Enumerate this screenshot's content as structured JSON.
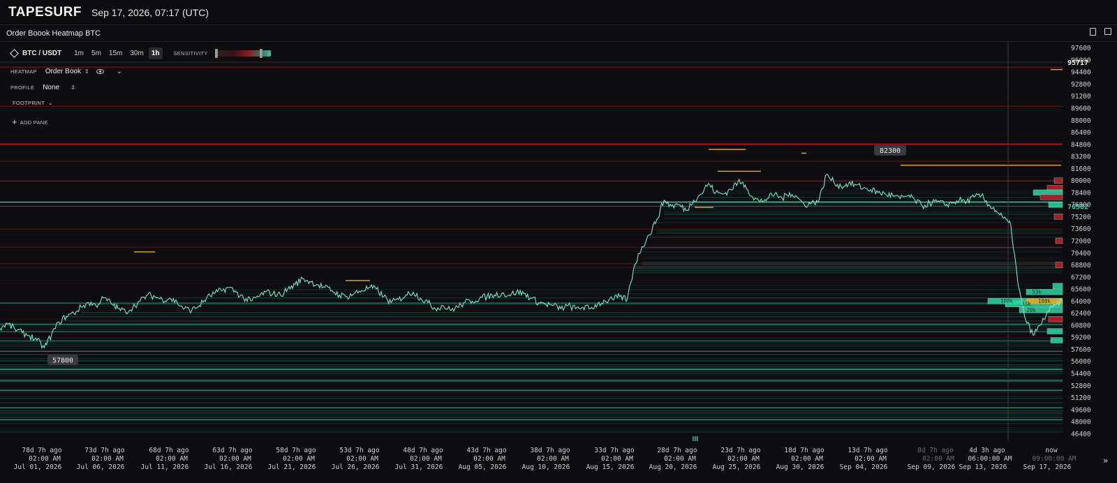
{
  "app": {
    "logo": "TAPESURF",
    "datetime": "Sep 17, 2026, 07:17 (UTC)",
    "pane_title": "Order Boook Heatmap BTC"
  },
  "controls": {
    "pair": "BTC / USDT",
    "timeframes": [
      "1m",
      "5m",
      "15m",
      "30m",
      "1h"
    ],
    "active_timeframe": "1h",
    "sensitivity_label": "SENSITIVITY",
    "heatmap_label": "HEATMAP",
    "heatmap_value": "Order Book",
    "profile_label": "PROFILE",
    "profile_value": "None",
    "footprint_label": "FOOTPRINT",
    "add_pane_label": "ADD PANE"
  },
  "colors": {
    "background": "#0e0e10",
    "bid": "#2fd3a3",
    "ask": "#c0212a",
    "accent": "#f0b429",
    "current_price": "#45d0b0"
  },
  "icons": [
    "binance-diamond-icon",
    "eye-icon",
    "chevron-down-icon",
    "plus-icon",
    "window-icon",
    "collapse-icon"
  ],
  "chart_data": {
    "type": "heatmap",
    "y_ticks": [
      97600,
      96000,
      94400,
      92800,
      91200,
      89600,
      88000,
      86400,
      84800,
      83200,
      81600,
      80000,
      78400,
      76800,
      75200,
      73600,
      72000,
      70400,
      68800,
      67200,
      65600,
      64000,
      62400,
      60800,
      59200,
      57600,
      56000,
      54400,
      52800,
      51200,
      49600,
      48000,
      46400
    ],
    "ylim": [
      45600,
      98400
    ],
    "x_ticks": [
      {
        "rel": "78d 7h ago",
        "time": "02:00 AM",
        "date": "Jul 01, 2026"
      },
      {
        "rel": "73d 7h ago",
        "time": "02:00 AM",
        "date": "Jul 06, 2026"
      },
      {
        "rel": "68d 7h ago",
        "time": "02:00 AM",
        "date": "Jul 11, 2026"
      },
      {
        "rel": "63d 7h ago",
        "time": "02:00 AM",
        "date": "Jul 16, 2026"
      },
      {
        "rel": "58d 7h ago",
        "time": "02:00 AM",
        "date": "Jul 21, 2026"
      },
      {
        "rel": "53d 7h ago",
        "time": "02:00 AM",
        "date": "Jul 26, 2026"
      },
      {
        "rel": "48d 7h ago",
        "time": "02:00 AM",
        "date": "Jul 31, 2026"
      },
      {
        "rel": "43d 7h ago",
        "time": "02:00 AM",
        "date": "Aug 05, 2026"
      },
      {
        "rel": "38d 7h ago",
        "time": "02:00 AM",
        "date": "Aug 10, 2026"
      },
      {
        "rel": "33d 7h ago",
        "time": "02:00 AM",
        "date": "Aug 15, 2026"
      },
      {
        "rel": "28d 7h ago",
        "time": "02:00 AM",
        "date": "Aug 20, 2026"
      },
      {
        "rel": "23d 7h ago",
        "time": "02:00 AM",
        "date": "Aug 25, 2026"
      },
      {
        "rel": "18d 7h ago",
        "time": "02:00 AM",
        "date": "Aug 30, 2026"
      },
      {
        "rel": "13d 7h ago",
        "time": "02:00 AM",
        "date": "Sep 04, 2026"
      },
      {
        "rel": "8d 7h ago",
        "time": "02:00 AM",
        "date": "Sep 09, 2026",
        "dim": true
      },
      {
        "rel": "4d 3h ago",
        "time": "06:00:00 AM",
        "date": "Sep 13, 2026"
      },
      {
        "rel": "now",
        "time": "09:00:00 AM",
        "date": "Sep 17, 2026",
        "dim": true
      }
    ],
    "price_series": [
      [
        0,
        60400
      ],
      [
        1,
        61000
      ],
      [
        2,
        60300
      ],
      [
        3,
        59800
      ],
      [
        4,
        59400
      ],
      [
        5,
        58800
      ],
      [
        6,
        57800
      ],
      [
        7,
        59600
      ],
      [
        8,
        61200
      ],
      [
        9,
        62000
      ],
      [
        10,
        62400
      ],
      [
        11,
        63200
      ],
      [
        12,
        63800
      ],
      [
        13,
        63400
      ],
      [
        14,
        64400
      ],
      [
        15,
        63800
      ],
      [
        16,
        63000
      ],
      [
        17,
        62600
      ],
      [
        18,
        63200
      ],
      [
        19,
        64000
      ],
      [
        20,
        64800
      ],
      [
        21,
        64600
      ],
      [
        22,
        64200
      ],
      [
        23,
        64400
      ],
      [
        24,
        63800
      ],
      [
        25,
        63000
      ],
      [
        26,
        62800
      ],
      [
        27,
        63400
      ],
      [
        28,
        64400
      ],
      [
        29,
        65000
      ],
      [
        30,
        65400
      ],
      [
        31,
        65800
      ],
      [
        32,
        65200
      ],
      [
        33,
        64400
      ],
      [
        34,
        64000
      ],
      [
        35,
        64600
      ],
      [
        36,
        65200
      ],
      [
        37,
        65000
      ],
      [
        38,
        64800
      ],
      [
        39,
        65600
      ],
      [
        40,
        66200
      ],
      [
        41,
        67000
      ],
      [
        42,
        66600
      ],
      [
        43,
        66200
      ],
      [
        44,
        65800
      ],
      [
        45,
        65400
      ],
      [
        46,
        64800
      ],
      [
        47,
        64600
      ],
      [
        48,
        65000
      ],
      [
        49,
        65400
      ],
      [
        50,
        65800
      ],
      [
        51,
        65600
      ],
      [
        52,
        64600
      ],
      [
        53,
        63800
      ],
      [
        54,
        64200
      ],
      [
        55,
        64800
      ],
      [
        56,
        65200
      ],
      [
        57,
        64400
      ],
      [
        58,
        63800
      ],
      [
        59,
        63000
      ],
      [
        60,
        63400
      ],
      [
        61,
        62800
      ],
      [
        62,
        63200
      ],
      [
        63,
        63800
      ],
      [
        64,
        64000
      ],
      [
        65,
        64400
      ],
      [
        66,
        64600
      ],
      [
        67,
        64800
      ],
      [
        68,
        65000
      ],
      [
        69,
        64800
      ],
      [
        70,
        65200
      ],
      [
        71,
        65000
      ],
      [
        72,
        64400
      ],
      [
        73,
        63800
      ],
      [
        74,
        63600
      ],
      [
        75,
        63400
      ],
      [
        76,
        63000
      ],
      [
        77,
        63400
      ],
      [
        78,
        63000
      ],
      [
        79,
        63200
      ],
      [
        80,
        63000
      ],
      [
        81,
        63600
      ],
      [
        82,
        64000
      ],
      [
        83,
        64200
      ],
      [
        84,
        64600
      ],
      [
        85,
        64200
      ],
      [
        86,
        68800
      ],
      [
        87,
        71200
      ],
      [
        88,
        72800
      ],
      [
        89,
        74800
      ],
      [
        90,
        77400
      ],
      [
        91,
        76600
      ],
      [
        92,
        76800
      ],
      [
        93,
        76000
      ],
      [
        94,
        77400
      ],
      [
        95,
        78200
      ],
      [
        96,
        79600
      ],
      [
        97,
        78400
      ],
      [
        98,
        78200
      ],
      [
        99,
        78800
      ],
      [
        100,
        79800
      ],
      [
        101,
        79400
      ],
      [
        102,
        77800
      ],
      [
        103,
        77200
      ],
      [
        104,
        77600
      ],
      [
        105,
        78200
      ],
      [
        106,
        77600
      ],
      [
        107,
        78400
      ],
      [
        108,
        77800
      ],
      [
        109,
        76800
      ],
      [
        110,
        77000
      ],
      [
        111,
        77400
      ],
      [
        112,
        80800
      ],
      [
        113,
        79800
      ],
      [
        114,
        79200
      ],
      [
        115,
        79600
      ],
      [
        116,
        79400
      ],
      [
        117,
        79000
      ],
      [
        118,
        78800
      ],
      [
        119,
        78400
      ],
      [
        120,
        78200
      ],
      [
        121,
        78000
      ],
      [
        122,
        77600
      ],
      [
        123,
        78000
      ],
      [
        124,
        77400
      ],
      [
        125,
        76600
      ],
      [
        126,
        77000
      ],
      [
        127,
        77200
      ],
      [
        128,
        76800
      ],
      [
        129,
        77000
      ],
      [
        130,
        77400
      ],
      [
        131,
        77200
      ],
      [
        132,
        77800
      ],
      [
        133,
        78000
      ],
      [
        134,
        76800
      ],
      [
        135,
        76000
      ],
      [
        136,
        75000
      ],
      [
        137,
        74000
      ],
      [
        138,
        66000
      ],
      [
        139,
        61500
      ],
      [
        140,
        59500
      ],
      [
        141,
        60800
      ],
      [
        142,
        62600
      ],
      [
        143,
        63400
      ],
      [
        144,
        64000
      ]
    ],
    "price_labels": {
      "low": "57800",
      "high": "82300",
      "current": "76582",
      "top": "95717"
    },
    "book_labels": [
      "53k",
      "100k",
      "100k",
      "33k",
      "20k"
    ]
  }
}
